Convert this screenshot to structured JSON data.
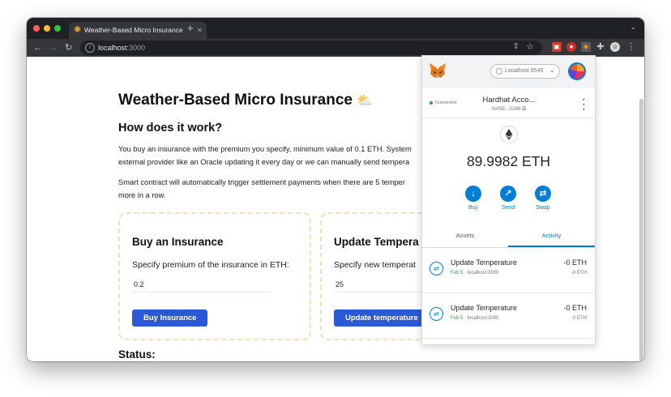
{
  "browser": {
    "tab": {
      "title": "Weather-Based Micro Insurance",
      "close": "×"
    },
    "new_tab": "+",
    "address": {
      "host": "localhost",
      "port": ":3000"
    }
  },
  "page": {
    "title": "Weather-Based Micro Insurance",
    "title_emoji": "⛅",
    "how_heading": "How does it work?",
    "paragraph1_line1": "You buy an insurance with the premium you specify, minimum value of 0.1 ETH. System",
    "paragraph1_line2": "external provider like an Oracle updating it every day or we can manually send tempera",
    "paragraph2_line1": "Smart contract will automatically trigger settlement payments when there are 5 temper",
    "paragraph2_line2": "more in a row.",
    "buy_card": {
      "title": "Buy an Insurance",
      "label": "Specify premium of the insurance in ETH:",
      "input_value": "0.2",
      "button": "Buy Insurance"
    },
    "update_card": {
      "title": "Update Tempera",
      "label": "Specify new temperat",
      "input_value": "25",
      "button": "Update temperature"
    },
    "status_heading": "Status:"
  },
  "metamask": {
    "network": "Localhost 8545",
    "connected": "Connected",
    "account_name": "Hardhat Acco...",
    "account_address": "0xf39...2266",
    "balance": "89.9982 ETH",
    "actions": [
      {
        "label": "Buy",
        "icon": "↓"
      },
      {
        "label": "Send",
        "icon": "↗"
      },
      {
        "label": "Swap",
        "icon": "⇄"
      }
    ],
    "tabs": [
      "Assets",
      "Activity"
    ],
    "activity": [
      {
        "title": "Update Temperature",
        "date": "Feb 5",
        "origin": " · localhost:3000",
        "amount": "-0 ETH",
        "amount_secondary": "-0 ETH"
      },
      {
        "title": "Update Temperature",
        "date": "Feb 5",
        "origin": " · localhost:3000",
        "amount": "-0 ETH",
        "amount_secondary": "-0 ETH"
      }
    ]
  },
  "colors": {
    "accent": "#2a59d6",
    "metamask_blue": "#037dd6",
    "card_border": "#f8dfb4"
  }
}
